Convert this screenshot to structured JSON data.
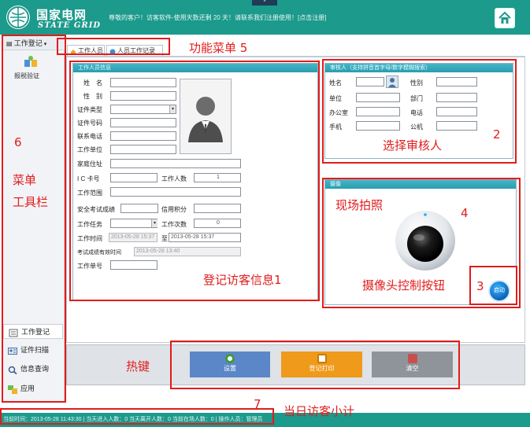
{
  "header": {
    "logo_cn": "国家电网",
    "logo_en": "STATE GRID",
    "message": "尊敬的客户！访客软件-使用天数还剩 20 天！请联系我们注册使用！[点击注册]",
    "home_icon": "home-icon"
  },
  "sidebar": {
    "title": "工作登记",
    "verify_label": "报税验证",
    "nav": [
      {
        "label": "工作登记",
        "icon": "form-icon"
      },
      {
        "label": "证件扫描",
        "icon": "id-card-icon"
      },
      {
        "label": "信息查询",
        "icon": "search-icon"
      },
      {
        "label": "应用",
        "icon": "apps-icon"
      }
    ]
  },
  "tabs": [
    {
      "label": "工作人员",
      "icon": "home-icon"
    },
    {
      "label": "人员工作记录",
      "icon": "globe-icon"
    }
  ],
  "staff_panel": {
    "title": "工作人员信息",
    "fields": {
      "name": "姓　名",
      "gender": "性　别",
      "id_type": "证件类型",
      "id_number": "证件号码",
      "phone": "联系电话",
      "work_unit": "工作单位",
      "home_address": "家庭住址",
      "ic_card": "I C 卡号",
      "work_count": "工作人数",
      "work_scope": "工作范围",
      "safety_exam": "安全考试成绩",
      "credit_score": "信用积分",
      "work_task": "工作任务",
      "work_times": "工作次数",
      "work_time": "工作时间",
      "to": "至",
      "exam_valid": "考试成绩有效时间",
      "work_ticket": "工作单号"
    },
    "values": {
      "work_count": "1",
      "work_times": "0",
      "time_start": "2013-05-28 15:37",
      "time_end": "2013-05-28 15:37",
      "exam_valid": "2013-05-28 13:40"
    }
  },
  "reviewer_panel": {
    "title": "审核人（支持拼音首字母/数字模糊搜索）",
    "fields": {
      "name": "姓名",
      "gender": "性别",
      "unit": "单位",
      "dept": "部门",
      "office": "办公室",
      "tel": "电话",
      "mobile": "手机",
      "office_phone": "公机"
    }
  },
  "camera_panel": {
    "title": "摄像",
    "start_label": "启动"
  },
  "hotkeys": {
    "settings": "设置",
    "print": "登记打印",
    "clear": "清空"
  },
  "statusbar": {
    "text": "当前时间：2013-05-28 11:43:30 | 当天进入人数：0 当天离开人数：0 当前在场人数：0 | 操作人员：管理员"
  },
  "annotations": {
    "func_menu": "功能菜单 5",
    "select_reviewer": "选择审核人",
    "num2": "2",
    "live_photo": "现场拍照",
    "num4": "4",
    "visitor_info": "登记访客信息1",
    "camera_ctrl": "摄像头控制按钮",
    "num3": "3",
    "num6": "6",
    "menu_line1": "菜单",
    "menu_line2": "工具栏",
    "hotkey": "热键",
    "num7": "7",
    "daily_summary": "当日访客小计"
  },
  "colors": {
    "header_teal": "#1c9a8c",
    "annotation_red": "#e11c1c",
    "settings_blue": "#5b87c8",
    "print_orange": "#ef9a1a",
    "clear_gray": "#8f949a"
  }
}
